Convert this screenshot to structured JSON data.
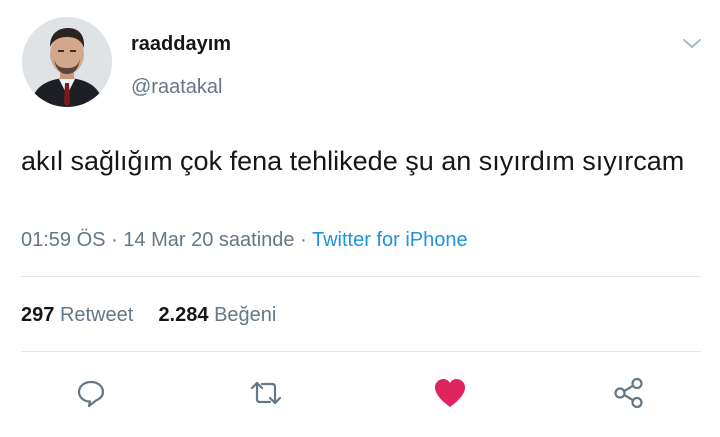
{
  "user": {
    "display_name": "raaddayım",
    "handle": "@raatakal"
  },
  "tweet": {
    "text": "akıl sağlığım çok fena tehlikede şu an sıyırdım sıyırcam",
    "time": "01:59 ÖS",
    "date": "14 Mar 20 saatinde",
    "separator": "·",
    "source": "Twitter for iPhone"
  },
  "stats": {
    "retweet_count": "297",
    "retweet_label": "Retweet",
    "like_count": "2.284",
    "like_label": "Beğeni"
  },
  "actions": {
    "icons": [
      "reply-icon",
      "retweet-icon",
      "heart-icon",
      "share-icon"
    ],
    "liked": true
  },
  "colors": {
    "text": "#14171a",
    "secondary": "#657786",
    "link": "#1b95e0",
    "like": "#e0245e",
    "divider": "#e1e8ed"
  }
}
